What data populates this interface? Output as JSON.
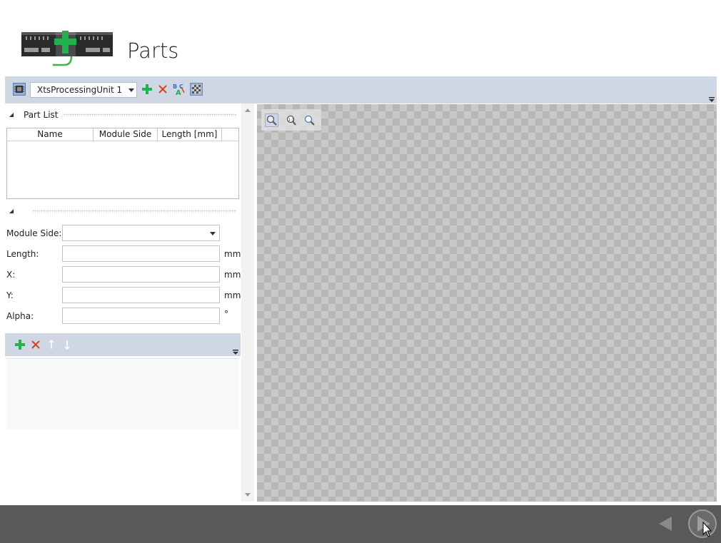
{
  "page": {
    "title": "Parts"
  },
  "toolbar": {
    "processing_unit": "XtsProcessingUnit 1",
    "icons": [
      "processing-unit-icon",
      "add-icon",
      "delete-icon",
      "rename-icon",
      "grid-toggle-icon"
    ]
  },
  "part_list": {
    "title": "Part List",
    "columns": [
      "Name",
      "Module Side",
      "Length [mm]"
    ],
    "rows": []
  },
  "details": {
    "module_side_label": "Module Side:",
    "module_side_value": "",
    "length_label": "Length:",
    "length_value": "",
    "length_unit": "mm",
    "x_label": "X:",
    "x_value": "",
    "x_unit": "mm",
    "y_label": "Y:",
    "y_value": "",
    "y_unit": "mm",
    "alpha_label": "Alpha:",
    "alpha_value": "",
    "alpha_unit": "°"
  },
  "sub_toolbar": {
    "icons": [
      "add-icon",
      "delete-icon",
      "move-up-icon",
      "move-down-icon"
    ]
  },
  "canvas": {
    "zoom_icons": [
      "zoom-fit-icon",
      "zoom-actual-icon",
      "zoom-icon"
    ]
  },
  "colors": {
    "toolbar_bg": "#cfd7e4",
    "footer_bg": "#595959",
    "add_green": "#22b14c",
    "delete_red": "#d9401f"
  }
}
